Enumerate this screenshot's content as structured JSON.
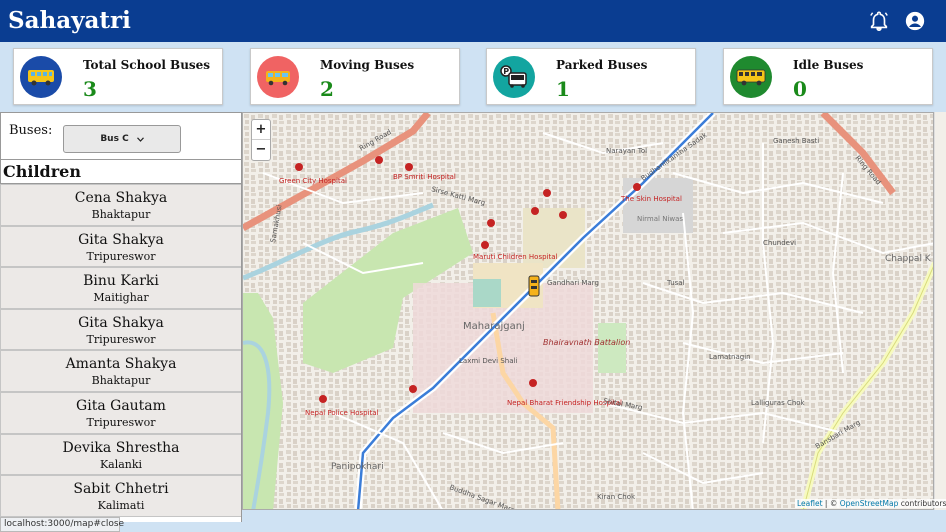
{
  "app": {
    "title": "Sahayatri"
  },
  "header_icons": [
    "bell-icon",
    "account-icon"
  ],
  "stats": [
    {
      "title": "Total School Buses",
      "value": "3",
      "icon": "school-bus-icon",
      "color": "#1a4ba8"
    },
    {
      "title": "Moving Buses",
      "value": "2",
      "icon": "moving-bus-icon",
      "color": "#f06363"
    },
    {
      "title": "Parked Buses",
      "value": "1",
      "icon": "parking-bus-icon",
      "color": "#13a5a0"
    },
    {
      "title": "Idle Buses",
      "value": "0",
      "icon": "idle-bus-icon",
      "color": "#1f8a2f"
    }
  ],
  "panel": {
    "buses_label": "Buses:",
    "selected_bus": "Bus C",
    "children_heading": "Children",
    "children": [
      {
        "name": "Cena Shakya",
        "location": "Bhaktapur"
      },
      {
        "name": "Gita Shakya",
        "location": "Tripureswor"
      },
      {
        "name": "Binu Karki",
        "location": "Maitighar"
      },
      {
        "name": "Gita Shakya",
        "location": "Tripureswor"
      },
      {
        "name": "Amanta Shakya",
        "location": "Bhaktapur"
      },
      {
        "name": "Gita Gautam",
        "location": "Tripureswor"
      },
      {
        "name": "Devika Shrestha",
        "location": "Kalanki"
      },
      {
        "name": "Sabit Chhetri",
        "location": "Kalimati"
      }
    ]
  },
  "map": {
    "zoom_in": "+",
    "zoom_out": "−",
    "attribution_leaflet": "Leaflet",
    "attribution_sep": " | © ",
    "attribution_osm": "OpenStreetMap",
    "attribution_tail": " contributors",
    "labels": {
      "ring_road_1": "Ring Road",
      "ring_road_2": "Ring Road",
      "green_city": "Green City Hospital",
      "bp_smriti": "BP Smriti Hospital",
      "sirse": "Sirse Katti Marg",
      "samakhusi": "Samakhusi",
      "narayan_tol": "Narayan Tol",
      "budhanilkantha": "Budhanilkantha Sadak",
      "skin_hospital": "The Skin Hospital",
      "nirmal_niwas": "Nirmal Niwas",
      "maruti": "Maruti Children Hospital",
      "gandhari": "Gandhari Marg",
      "maharajganj": "Maharajganj",
      "bhairavnath": "Bhairavnath Battalion",
      "laxmi": "Laxmi Devi Shali",
      "nepal_police": "Nepal Police Hospital",
      "nepal_bharat": "Nepal Bharat Friendship Hospital",
      "shital": "Shital Marg",
      "panipokhari": "Panipokhari",
      "kiran_chok": "Kiran Chok",
      "ganesh_basti": "Ganesh Basti",
      "chundevi": "Chundevi",
      "tusal": "Tusal",
      "lamatnagin": "Lamatnagin",
      "lalliguras": "Lalliguras Chok",
      "chappal": "Chappal K",
      "bansbari": "Bansbari Marg",
      "budhha_sagar": "Buddha Sagar Marg"
    }
  },
  "status_bar": "localhost:3000/map#close"
}
